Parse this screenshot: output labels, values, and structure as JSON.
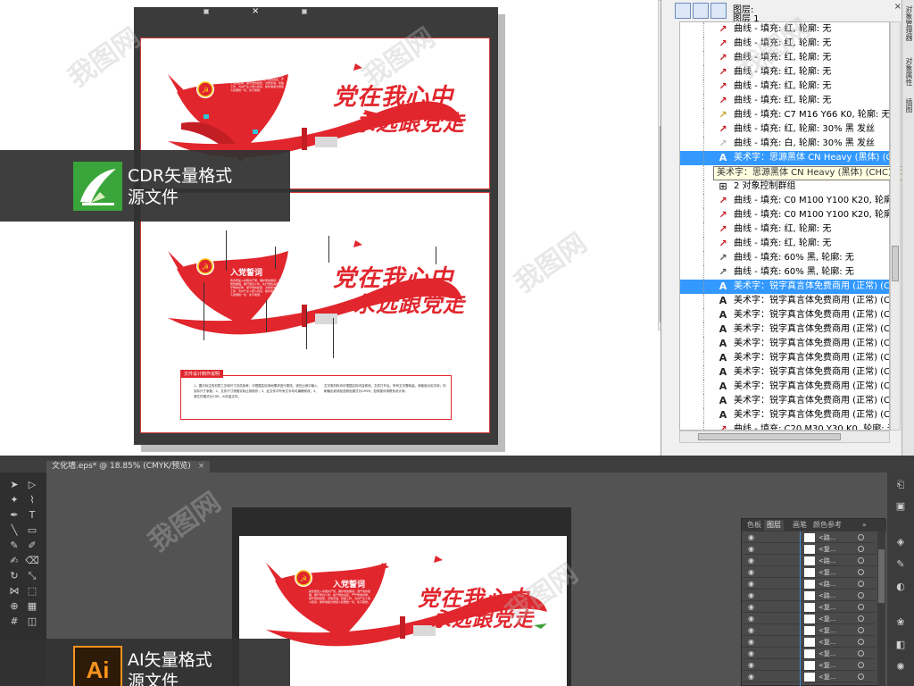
{
  "cdr": {
    "badge_text_line1": "CDR矢量格式",
    "badge_text_line2": "源文件",
    "handle_x": "×"
  },
  "artwork": {
    "slogan_line1": "党在我心中",
    "slogan_line2": "永远跟党走",
    "oath_title": "入党誓词",
    "oath_body": "我志愿加入中国共产党，拥护党的纲领，遵守党的章程，履行党员义务，执行党的决定，严守党的纪律，保守党的秘密，对党忠诚，积极工作，为共产主义奋斗终身，随时准备为党和人民牺牲一切，永不叛党。",
    "desc_title": "文件设计制作说明",
    "desc_col1": "1、图中标注的材质工艺和尺寸仅供参考，可根据实际场地需求进行更改，请在比例中输入实际尺寸参数；2、文件尺寸按照实际比例制作；3、此文件中所有文字均可编辑修改；4、源文件格式为CDR、AI矢量文件。",
    "desc_col2": "文字类材料均可根据实际内容修改；文件打开后，所有文字需转曲，请使用对应字体；印刷输出前请检查颜色模式为CMYK；如有疑问请联系设计师。"
  },
  "object_manager": {
    "layer_label_line1": "图层:",
    "layer_label_line2": "图层 1",
    "close_icon": "×",
    "side_tabs": [
      "对象管理器",
      "对象属性",
      "插图"
    ],
    "tooltip": "美术字：思源黑体 CN Heavy (黑体) (CHC) - 填...",
    "rows": [
      {
        "icon": "curve",
        "text": "曲线 - 填充: 红, 轮廓: 无",
        "selected": false
      },
      {
        "icon": "curve",
        "text": "曲线 - 填充: 红, 轮廓: 无",
        "selected": false
      },
      {
        "icon": "curve",
        "text": "曲线 - 填充: 红, 轮廓: 无",
        "selected": false
      },
      {
        "icon": "curve",
        "text": "曲线 - 填充: 红, 轮廓: 无",
        "selected": false
      },
      {
        "icon": "curve",
        "text": "曲线 - 填充: 红, 轮廓: 无",
        "selected": false
      },
      {
        "icon": "curve",
        "text": "曲线 - 填充: 红, 轮廓: 无",
        "selected": false
      },
      {
        "icon": "curve-yellow",
        "text": "曲线 - 填充: C7 M16 Y66 K0, 轮廓: 无",
        "selected": false
      },
      {
        "icon": "curve",
        "text": "曲线 - 填充: 红, 轮廓: 30% 黑 发丝",
        "selected": false
      },
      {
        "icon": "curve-white",
        "text": "曲线 - 填充: 白, 轮廓: 30% 黑 发丝",
        "selected": false
      },
      {
        "icon": "text",
        "text": "美术字：思源黑体 CN Heavy (黑体) (CHC)",
        "selected": true
      },
      {
        "icon": "text",
        "text": "美术字：思源黑体 CN Heavy (黑体) (CHC)",
        "selected": false
      },
      {
        "icon": "group",
        "text": "2 对象控制群组",
        "selected": false
      },
      {
        "icon": "curve",
        "text": "曲线 - 填充: C0 M100 Y100 K20, 轮廓: 无",
        "selected": false
      },
      {
        "icon": "curve",
        "text": "曲线 - 填充: C0 M100 Y100 K20, 轮廓: 无",
        "selected": false
      },
      {
        "icon": "curve",
        "text": "曲线 - 填充: 红, 轮廓: 无",
        "selected": false
      },
      {
        "icon": "curve",
        "text": "曲线 - 填充: 红, 轮廓: 无",
        "selected": false
      },
      {
        "icon": "curve-dark",
        "text": "曲线 - 填充: 60% 黑, 轮廓: 无",
        "selected": false
      },
      {
        "icon": "curve-dark",
        "text": "曲线 - 填充: 60% 黑, 轮廓: 无",
        "selected": false
      },
      {
        "icon": "text",
        "text": "美术字：锐字真言体免费商用 (正常) (CHC)",
        "selected": true
      },
      {
        "icon": "text",
        "text": "美术字：锐字真言体免费商用 (正常) (CHC)",
        "selected": false
      },
      {
        "icon": "text",
        "text": "美术字：锐字真言体免费商用 (正常) (CHC)",
        "selected": false
      },
      {
        "icon": "text",
        "text": "美术字：锐字真言体免费商用 (正常) (CHC)",
        "selected": false
      },
      {
        "icon": "text",
        "text": "美术字：锐字真言体免费商用 (正常) (CHC)",
        "selected": false
      },
      {
        "icon": "text",
        "text": "美术字：锐字真言体免费商用 (正常) (CHC)",
        "selected": false
      },
      {
        "icon": "text",
        "text": "美术字：锐字真言体免费商用 (正常) (CHC)",
        "selected": false
      },
      {
        "icon": "text",
        "text": "美术字：锐字真言体免费商用 (正常) (CHC)",
        "selected": false
      },
      {
        "icon": "text",
        "text": "美术字：锐字真言体免费商用 (正常) (CHC)",
        "selected": false
      },
      {
        "icon": "text",
        "text": "美术字：锐字真言体免费商用 (正常) (CHC)",
        "selected": false
      },
      {
        "icon": "curve",
        "text": "曲线 - 填充: C20 M30 Y30 K0, 轮廓: 无",
        "selected": false
      }
    ]
  },
  "ai": {
    "tab_title": "文化墙.eps* @ 18.85% (CMYK/预览)",
    "tab_close": "×",
    "badge_text_line1": "AI矢量格式",
    "badge_text_line2": "源文件",
    "badge_logo": "Ai",
    "layers_tabs": [
      "色板",
      "图层",
      "画笔",
      "颜色参考"
    ],
    "layers_menu": "»",
    "layer_rows": [
      {
        "name": "<路..."
      },
      {
        "name": "<复..."
      },
      {
        "name": "<路..."
      },
      {
        "name": "<复..."
      },
      {
        "name": "<路..."
      },
      {
        "name": "<路..."
      },
      {
        "name": "<复..."
      },
      {
        "name": "<复..."
      },
      {
        "name": "<复..."
      },
      {
        "name": "<复..."
      },
      {
        "name": "<复..."
      },
      {
        "name": "<复..."
      },
      {
        "name": "<复..."
      }
    ]
  },
  "watermark": "我图网",
  "colors": {
    "party_red": "#e1262d",
    "selection_blue": "#3399ff",
    "cdr_green": "#3aa53a",
    "ai_orange": "#f7941d"
  }
}
